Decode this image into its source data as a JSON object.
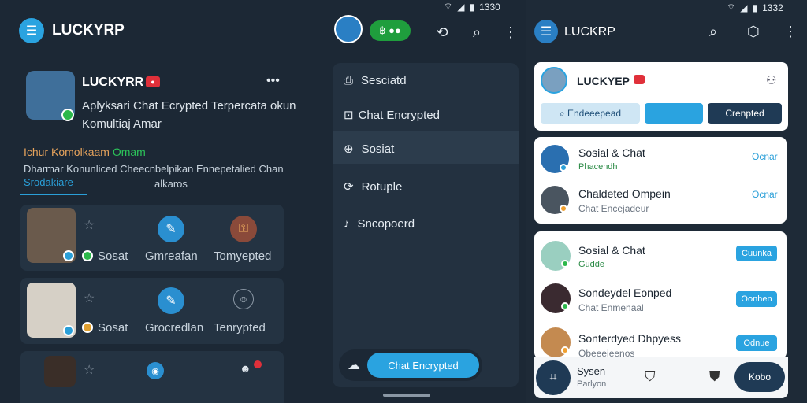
{
  "status_left": {
    "time": "1330"
  },
  "status_right": {
    "time": "1332"
  },
  "main": {
    "app_title": "LUCKYRP",
    "online_pill": "฿ ●●",
    "profile": {
      "name": "LUCKYRR",
      "badge": "●",
      "desc_line1": "Aplyksari Chat Ecrypted Terpercata okun",
      "desc_line2": "Komultiaj Amar",
      "more": "•••"
    },
    "section": {
      "prefix": "Ichur Komolkaam",
      "accent": "Omam",
      "desc_line1": "Dharmar Konunliced Cheecnbelpikan Ennepetalied Chan",
      "desc_line2": "alkaros",
      "tab_label": "Srodakiare"
    },
    "cards": [
      {
        "a": "Sosat",
        "b": "Gmreafan",
        "c": "Tomyepted"
      },
      {
        "a": "Sosat",
        "b": "Grocredlan",
        "c": "Tenrypted"
      }
    ],
    "side_menu": [
      {
        "icon": "document-icon",
        "label": "Sesciatd"
      },
      {
        "icon": "chat-icon",
        "label": "Chat Encrypted"
      },
      {
        "icon": "globe-icon",
        "label": "Sosiat"
      },
      {
        "icon": "refresh-icon",
        "label": "Rotuple"
      },
      {
        "icon": "music-icon",
        "label": "Sncopoerd"
      }
    ],
    "chat_button": "Chat Encrypted"
  },
  "right": {
    "app_title": "LUCKRP",
    "profile_name": "LUCKYEP",
    "search_label": "Endeeepead",
    "encrypted_btn": "Crenpted",
    "group1": [
      {
        "title": "Sosial & Chat",
        "sub": "Phacendh",
        "action": "Ocnar",
        "status": "#2cb84b"
      },
      {
        "title": "Chaldeted Ompein",
        "sub": "Chat Encejadeur",
        "action": "Ocnar",
        "status": "#f0a030"
      }
    ],
    "group2": [
      {
        "title": "Sosial & Chat",
        "sub": "Gudde",
        "action": "Cuunka",
        "status": "#2cb84b"
      },
      {
        "title": "Sondeydel Eonped",
        "sub": "Chat Enmenaal",
        "action": "Oonhen",
        "status": "#2cb84b"
      },
      {
        "title": "Sonterdyed Dhpyess",
        "sub": "Obeeeieenos",
        "action": "Odnue",
        "status": "#f0a030"
      }
    ],
    "bottom": {
      "label1": "Sysen",
      "label2": "Parlyon",
      "action": "Kobo"
    }
  }
}
